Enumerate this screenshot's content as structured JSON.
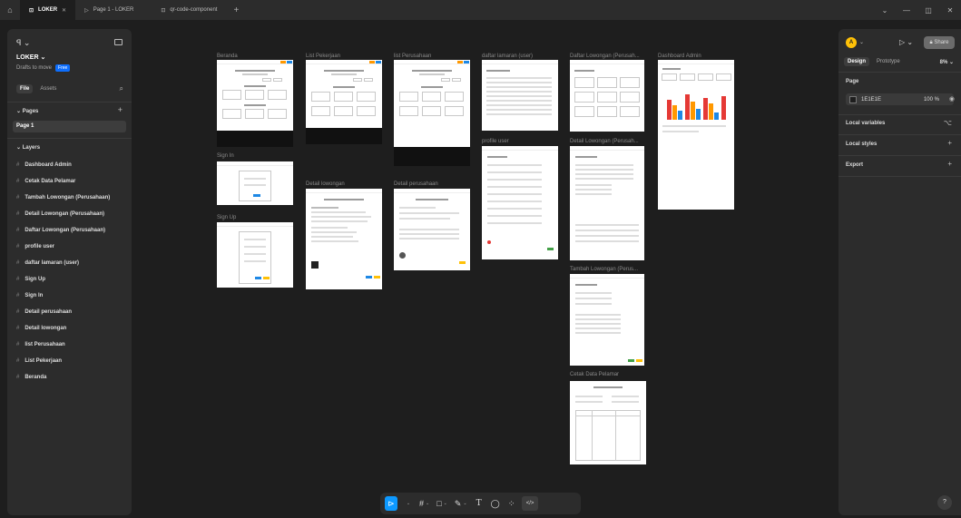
{
  "titlebar": {
    "tabs": [
      {
        "label": "LOKER"
      },
      {
        "label": "Page 1 - LOKER"
      },
      {
        "label": "qr-code-component"
      }
    ],
    "add_tab": "+"
  },
  "left_panel": {
    "project_name": "LOKER",
    "drafts_text": "Drafts to move",
    "free_badge": "Free",
    "tabs": [
      "File",
      "Assets"
    ],
    "pages_header": "Pages",
    "pages": [
      "Page 1"
    ],
    "layers_header": "Layers",
    "layers": [
      "Dashboard Admin",
      "Cetak Data Pelamar",
      "Tambah Lowongan (Perusahaan)",
      "Detail Lowongan (Perusahaan)",
      "Daftar Lowongan (Perusahaan)",
      "profile user",
      "daftar lamaran (user)",
      "Sign Up",
      "Sign In",
      "Detail perusahaan",
      "Detail lowongan",
      "list Perusahaan",
      "List Pekerjaan",
      "Beranda"
    ]
  },
  "right_panel": {
    "avatar_letter": "A",
    "share_label": "Share",
    "tabs": [
      "Design",
      "Prototype"
    ],
    "zoom": "8%",
    "page_section": "Page",
    "background_hex": "1E1E1E",
    "background_opacity": "100",
    "opacity_unit": "%",
    "sections": [
      "Local variables",
      "Local styles",
      "Export"
    ],
    "help": "?"
  },
  "canvas": {
    "frames": [
      {
        "label": "Beranda"
      },
      {
        "label": "List Pekerjaan"
      },
      {
        "label": "list Perusahaan"
      },
      {
        "label": "daftar lamaran (user)"
      },
      {
        "label": "Daftar Lowongan (Perusah..."
      },
      {
        "label": "Dashboard Admin"
      },
      {
        "label": "Sign In"
      },
      {
        "label": "Sign Up"
      },
      {
        "label": "Detail lowongan"
      },
      {
        "label": "Detail perusahaan"
      },
      {
        "label": "profile user"
      },
      {
        "label": "Detail Lowongan (Perusah..."
      },
      {
        "label": "Tambah Lowongan (Perus..."
      },
      {
        "label": "Cetak Data Pelamar"
      }
    ]
  },
  "toolbar": {
    "tools": [
      "move-tool",
      "frame-tool",
      "shape-tool",
      "pen-tool",
      "text-tool",
      "comment-tool",
      "actions-tool",
      "dev-mode-toggle"
    ],
    "text_glyph": "T",
    "dev_glyph": "</>"
  },
  "colors": {
    "canvas_bg": "#1e1e1e",
    "panel_bg": "#2c2c2c",
    "accent_blue": "#0d99ff",
    "frame_bg": "#ffffff",
    "chart_red": "#e53935",
    "chart_orange": "#ff9800",
    "chart_blue": "#1e88e5"
  }
}
